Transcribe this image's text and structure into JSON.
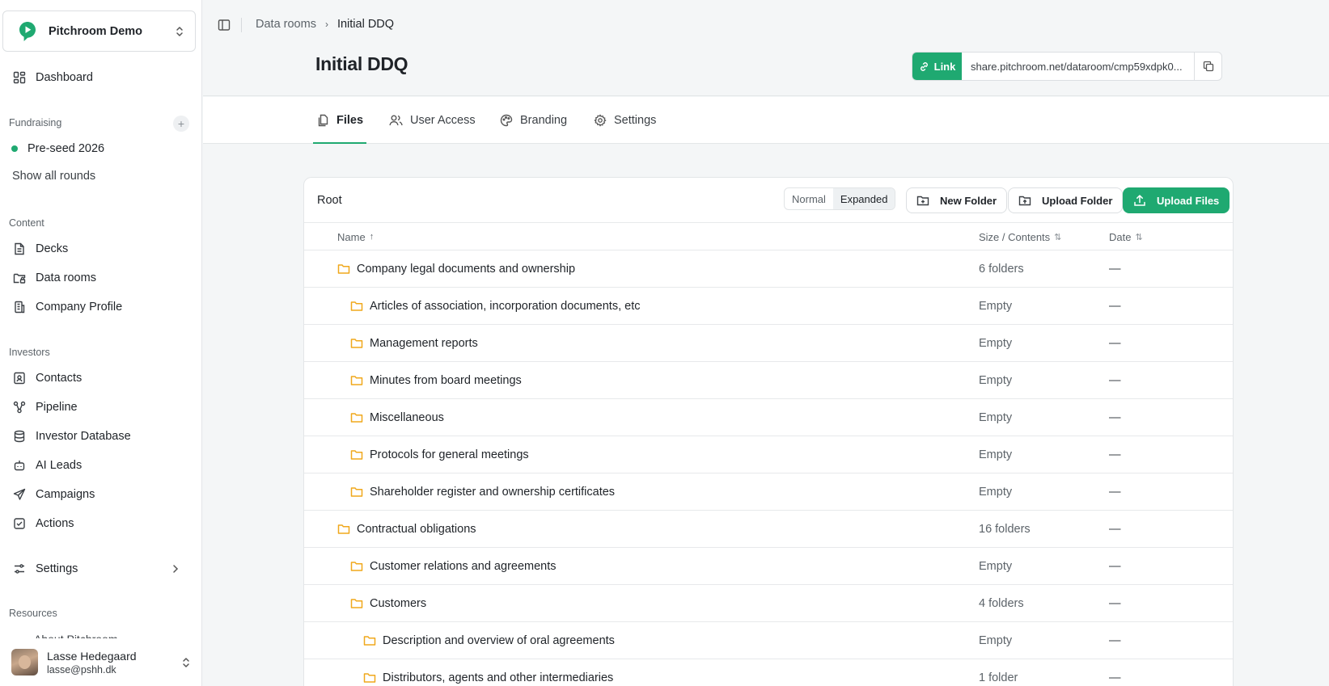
{
  "workspace": {
    "name": "Pitchroom Demo"
  },
  "sidebar": {
    "dashboard": "Dashboard",
    "fundraising_label": "Fundraising",
    "round": "Pre-seed 2026",
    "show_all_rounds": "Show all rounds",
    "content_label": "Content",
    "content_items": [
      "Decks",
      "Data rooms",
      "Company Profile"
    ],
    "investors_label": "Investors",
    "investor_items": [
      "Contacts",
      "Pipeline",
      "Investor Database",
      "AI Leads",
      "Campaigns",
      "Actions"
    ],
    "settings": "Settings",
    "resources_label": "Resources",
    "resources_partial": "About Pitchroom"
  },
  "user": {
    "name": "Lasse Hedegaard",
    "email": "lasse@pshh.dk"
  },
  "breadcrumb": {
    "parent": "Data rooms",
    "current": "Initial DDQ"
  },
  "page": {
    "title": "Initial DDQ"
  },
  "share": {
    "link_label": "Link",
    "url": "share.pitchroom.net/dataroom/cmp59xdpk0..."
  },
  "tabs": [
    {
      "label": "Files",
      "icon": "files-icon"
    },
    {
      "label": "User Access",
      "icon": "users-icon"
    },
    {
      "label": "Branding",
      "icon": "palette-icon"
    },
    {
      "label": "Settings",
      "icon": "gear-icon"
    }
  ],
  "files": {
    "root_label": "Root",
    "view_modes": [
      "Normal",
      "Expanded"
    ],
    "active_view": "Expanded",
    "new_folder": "New Folder",
    "upload_folder": "Upload Folder",
    "upload_files": "Upload Files",
    "columns": {
      "name": "Name",
      "name_sort": "↑",
      "size": "Size / Contents",
      "size_sort": "⇅",
      "date": "Date",
      "date_sort": "⇅"
    },
    "rows": [
      {
        "name": "Company legal documents and ownership",
        "size": "6 folders",
        "date": "—",
        "level": 0
      },
      {
        "name": "Articles of association, incorporation documents, etc",
        "size": "Empty",
        "date": "—",
        "level": 1
      },
      {
        "name": "Management reports",
        "size": "Empty",
        "date": "—",
        "level": 1
      },
      {
        "name": "Minutes from board meetings",
        "size": "Empty",
        "date": "—",
        "level": 1
      },
      {
        "name": "Miscellaneous",
        "size": "Empty",
        "date": "—",
        "level": 1
      },
      {
        "name": "Protocols for general meetings",
        "size": "Empty",
        "date": "—",
        "level": 1
      },
      {
        "name": "Shareholder register and ownership certificates",
        "size": "Empty",
        "date": "—",
        "level": 1
      },
      {
        "name": "Contractual obligations",
        "size": "16 folders",
        "date": "—",
        "level": 0
      },
      {
        "name": "Customer relations and agreements",
        "size": "Empty",
        "date": "—",
        "level": 1
      },
      {
        "name": "Customers",
        "size": "4 folders",
        "date": "—",
        "level": 1
      },
      {
        "name": "Description and overview of oral agreements",
        "size": "Empty",
        "date": "—",
        "level": 2
      },
      {
        "name": "Distributors, agents and other intermediaries",
        "size": "1 folder",
        "date": "—",
        "level": 2
      }
    ]
  },
  "colors": {
    "accent": "#1fa971",
    "folder": "#f0a81c"
  }
}
